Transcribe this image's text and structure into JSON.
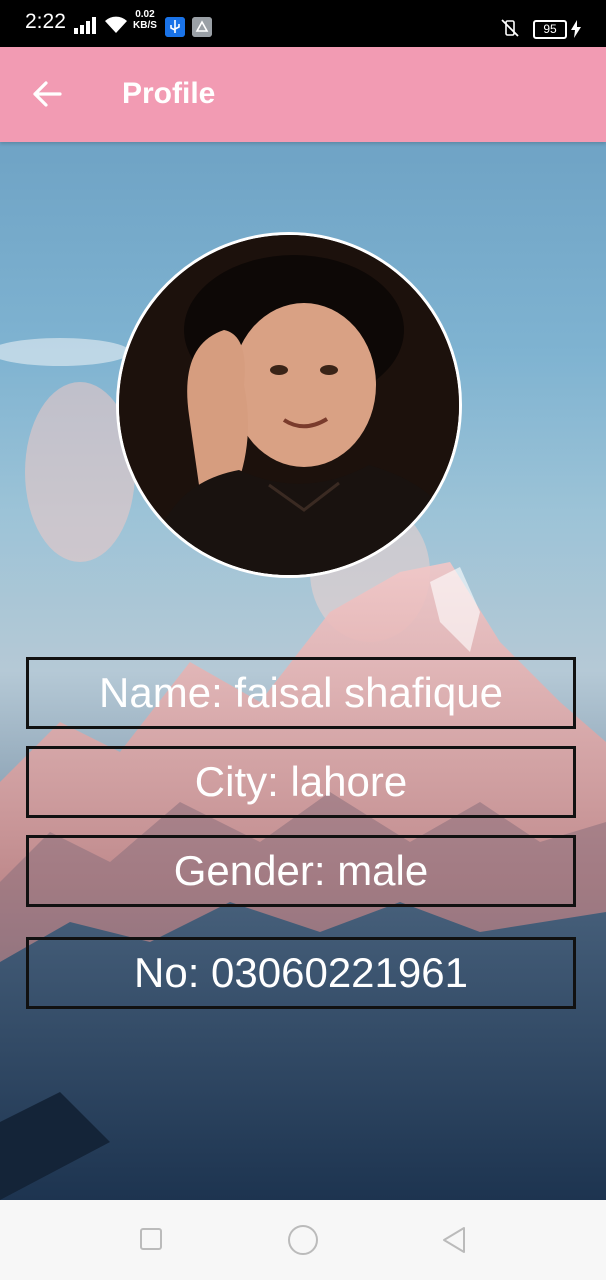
{
  "status_bar": {
    "time": "2:22",
    "speed_value": "0.02",
    "speed_unit": "KB/S",
    "battery": "95"
  },
  "app_bar": {
    "title": "Profile",
    "back_icon": "arrow-left-icon",
    "color": "#f29bb3"
  },
  "profile": {
    "avatar": "profile-photo",
    "fields": [
      "Name: faisal shafique",
      "City: lahore",
      "Gender: male",
      "No: 03060221961"
    ]
  },
  "nav_bar": {
    "icons": [
      "recents-square-icon",
      "home-circle-icon",
      "back-triangle-icon"
    ]
  }
}
